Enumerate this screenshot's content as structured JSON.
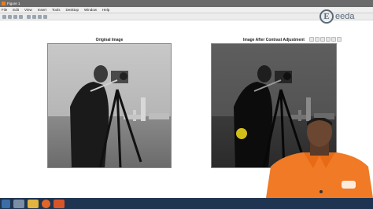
{
  "window": {
    "title": "Figure 1"
  },
  "menubar": {
    "items": [
      "File",
      "Edit",
      "View",
      "Insert",
      "Tools",
      "Desktop",
      "Window",
      "Help"
    ]
  },
  "brand": {
    "logo_text": "eeda",
    "logo_letter": "E"
  },
  "axes": [
    {
      "title": "Original Image"
    },
    {
      "title": "Image After Contrast Adjustment"
    }
  ],
  "colors": {
    "titlebar": "#6b6b6b",
    "taskbar": "#1f3450",
    "presenter_shirt": "#f07a26",
    "highlight": "#e8d21a"
  },
  "taskbar": {
    "icons": [
      "start-icon",
      "file-explorer-icon",
      "folder-icon",
      "firefox-icon",
      "matlab-icon"
    ]
  }
}
